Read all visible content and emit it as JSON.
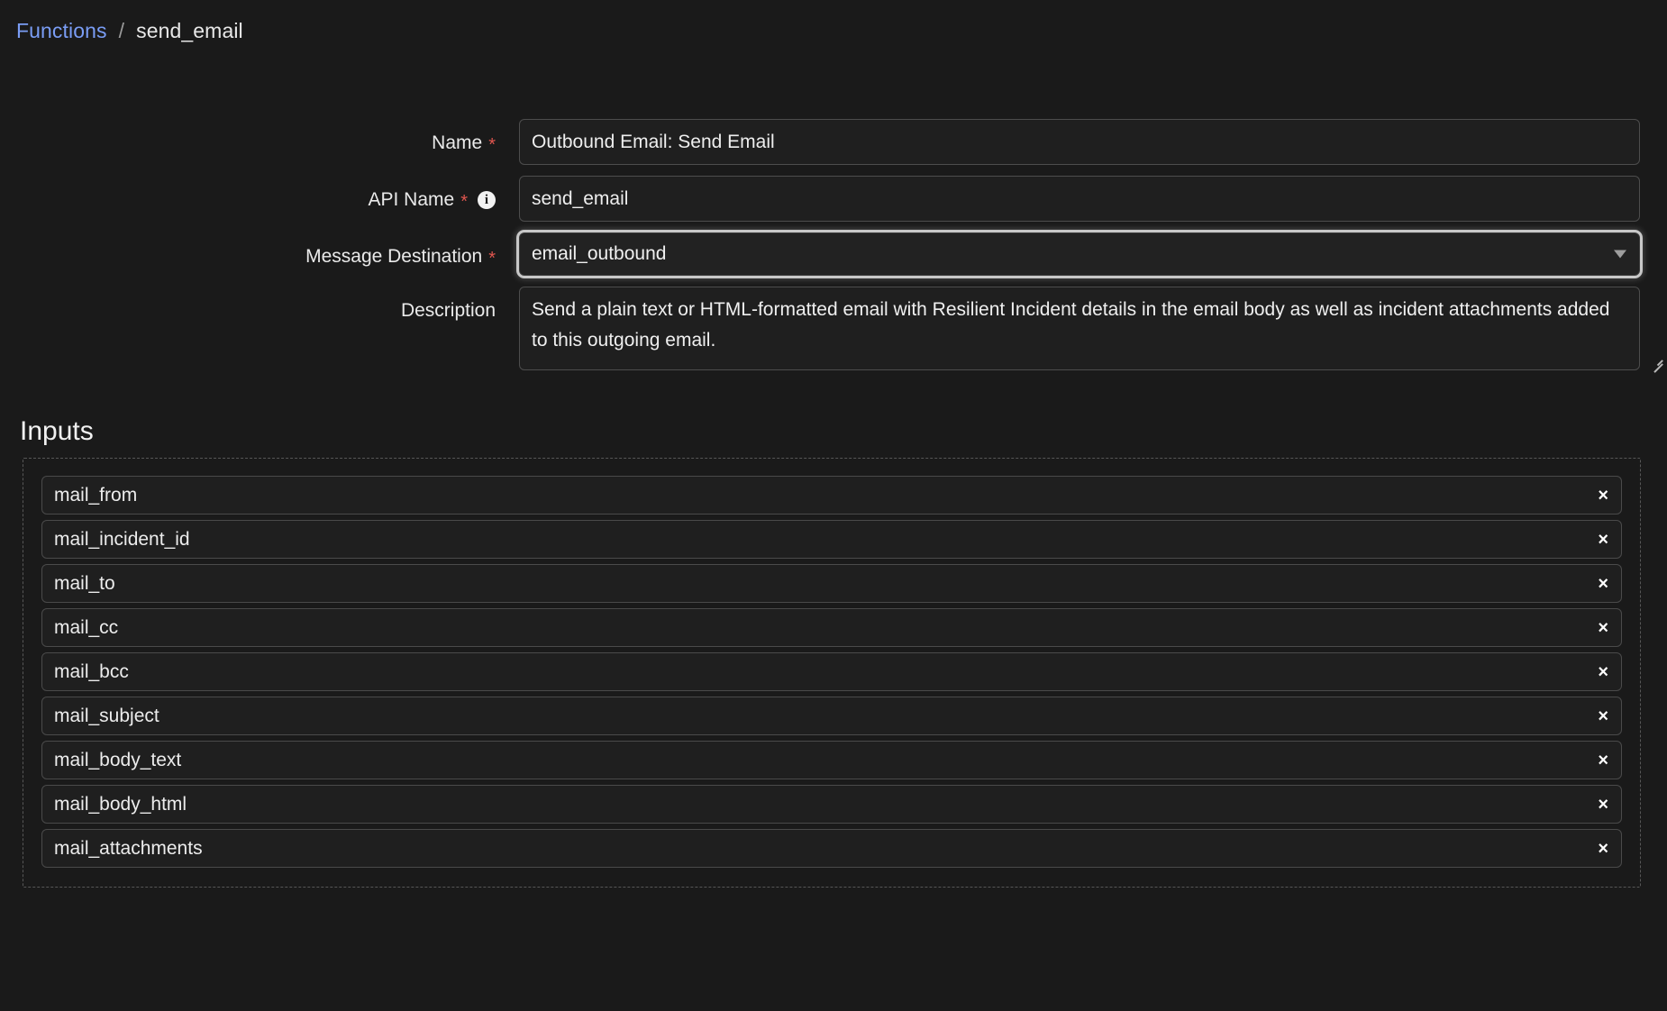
{
  "breadcrumb": {
    "root_label": "Functions",
    "separator": "/",
    "current_label": "send_email"
  },
  "form": {
    "name": {
      "label": "Name",
      "required_marker": "*",
      "value": "Outbound Email: Send Email"
    },
    "api_name": {
      "label": "API Name",
      "required_marker": "*",
      "info_glyph": "i",
      "value": "send_email"
    },
    "message_destination": {
      "label": "Message Destination",
      "required_marker": "*",
      "value": "email_outbound"
    },
    "description": {
      "label": "Description",
      "value": "Send a plain text or HTML-formatted email with Resilient Incident details in the email body as well as incident attachments added to this outgoing email."
    }
  },
  "inputs_section": {
    "title": "Inputs",
    "remove_glyph": "×",
    "items": [
      {
        "label": "mail_from"
      },
      {
        "label": "mail_incident_id"
      },
      {
        "label": "mail_to"
      },
      {
        "label": "mail_cc"
      },
      {
        "label": "mail_bcc"
      },
      {
        "label": "mail_subject"
      },
      {
        "label": "mail_body_text"
      },
      {
        "label": "mail_body_html"
      },
      {
        "label": "mail_attachments"
      }
    ]
  },
  "colors": {
    "background": "#1a1a1a",
    "link": "#7a9df5",
    "required": "#e0564f",
    "field_border": "#4d4d4d",
    "text": "#ececec"
  }
}
